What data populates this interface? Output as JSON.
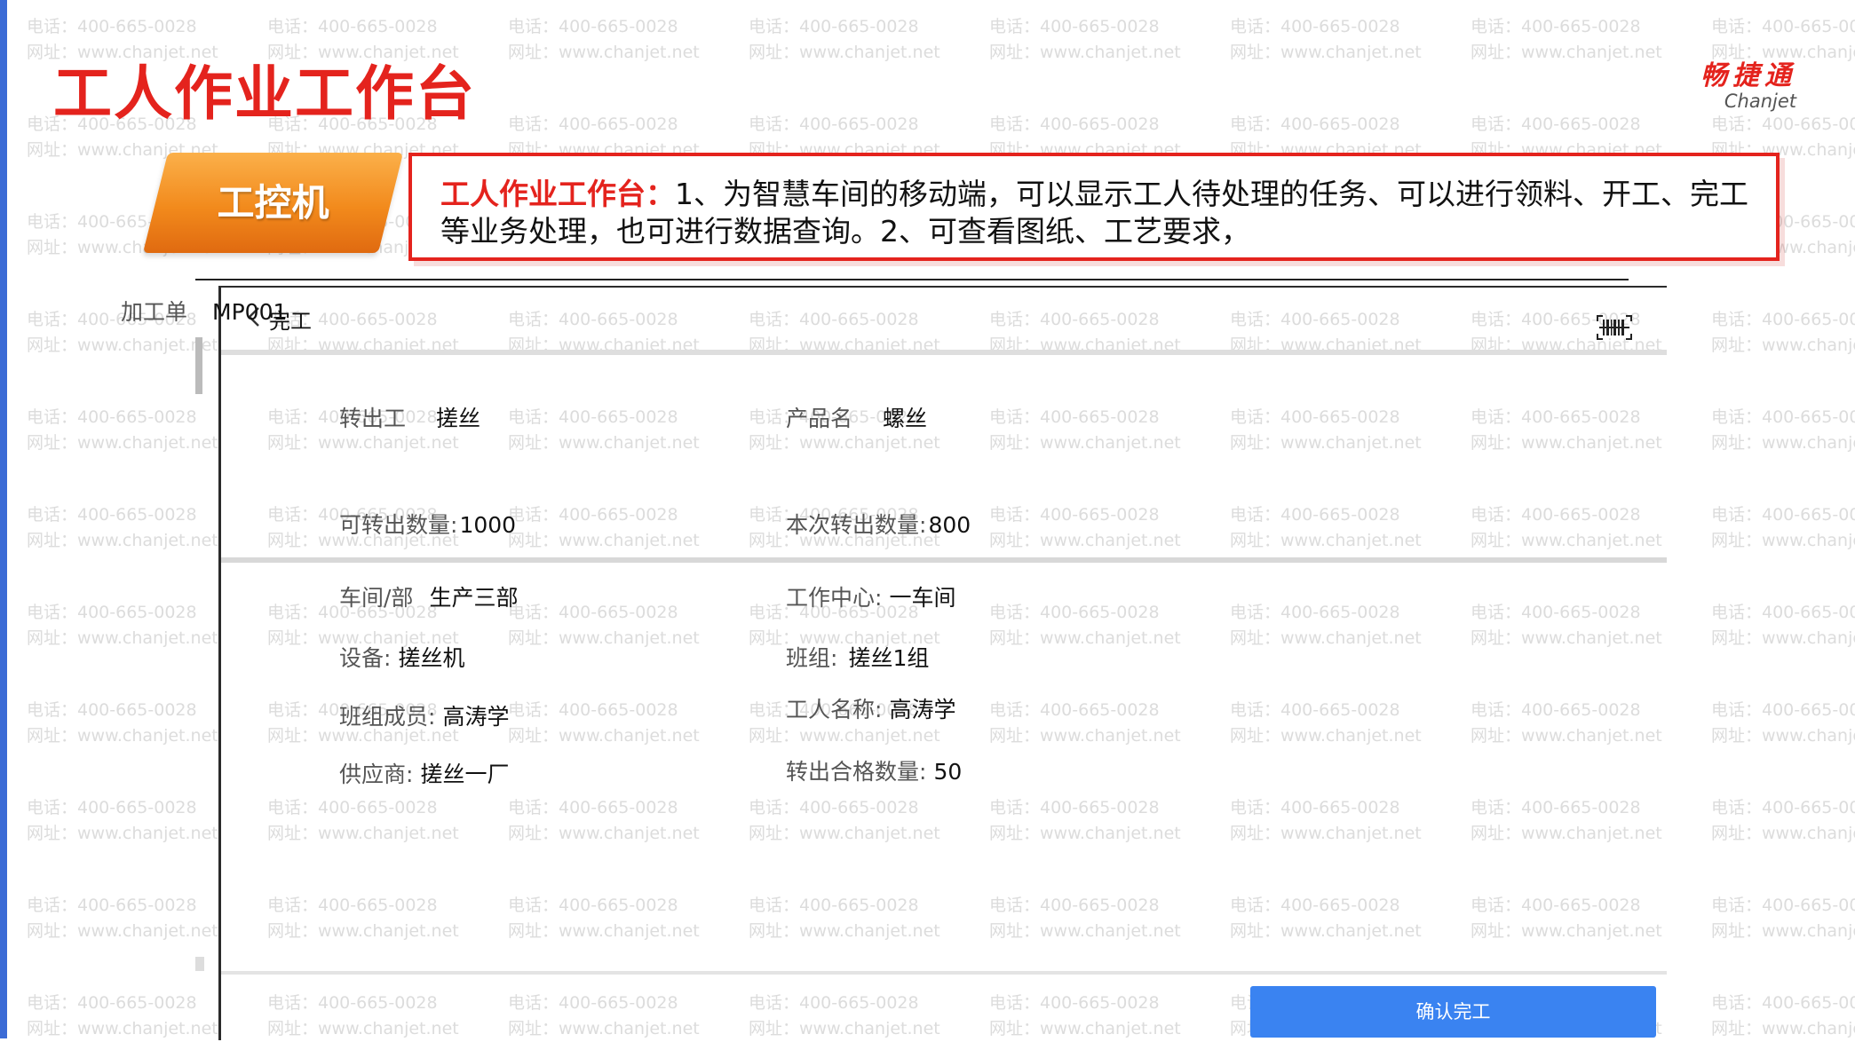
{
  "slide": {
    "title": "工人作业工作台",
    "logo_cn": "畅捷通",
    "logo_en": "Chanjet",
    "badge": "工控机",
    "callout_head": "工人作业工作台：",
    "callout_body": "1、为智慧车间的移动端，可以显示工人待处理的任务、可以进行领料、开工、完工等业务处理，也可进行数据查询。2、可查看图纸、工艺要求，"
  },
  "watermark": {
    "phone": "电话：400-665-0028",
    "site": "网址：www.chanjet.net"
  },
  "app": {
    "nav_title": "完工",
    "section1": {
      "order_label": "加工单",
      "order_value": "MP001",
      "transfer_out_label": "转出工",
      "transfer_out_value": "搓丝",
      "product_label": "产品名",
      "product_value": "螺丝",
      "available_qty_label": "可转出数量:",
      "available_qty_value": "1000",
      "this_qty_label": "本次转出数量:",
      "this_qty_value": "800"
    },
    "section2": {
      "dept_label": "车间/部",
      "dept_value": "生产三部",
      "work_center_label": "工作中心:",
      "work_center_value": "一车间",
      "device_label": "设备:",
      "device_value": "搓丝机",
      "team_label": "班组:",
      "team_value": "搓丝1组",
      "member_label": "班组成员:",
      "member_value": "高涛学",
      "worker_label": "工人名称:",
      "worker_value": "高涛学",
      "supplier_label": "供应商:",
      "supplier_value": "搓丝一厂",
      "qualified_label": "转出合格数量:",
      "qualified_value": "50"
    },
    "confirm_label": "确认完工"
  },
  "colors": {
    "brand_red": "#e4231d",
    "badge_orange": "#f28a1c",
    "button_blue": "#3a83f1",
    "accent_left": "#3b6bd6"
  }
}
